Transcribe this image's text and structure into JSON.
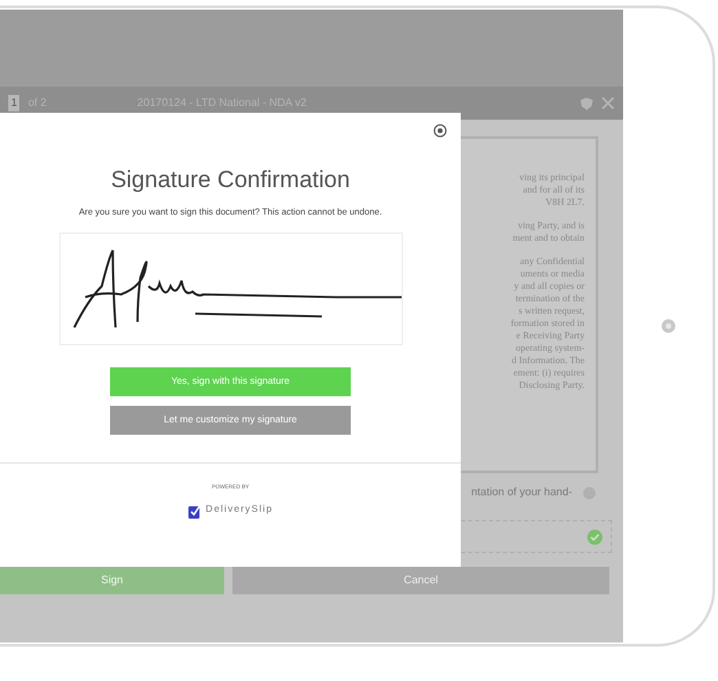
{
  "toolbar": {
    "page": "1",
    "page_count": "of 2",
    "document_title": "20170124 - LTD National - NDA v2"
  },
  "document": {
    "paragraphs": [
      [
        "ving its principal",
        "and for all of its",
        "V8H 2L7."
      ],
      [
        "ving Party, and is",
        "ment and to obtain"
      ],
      [
        "any Confidential",
        "uments or media",
        "y and all copies or",
        "termination of the",
        "s written request,",
        "formation stored in",
        "e Receiving Party",
        "operating system-",
        "d Information. The",
        "ement: (i) requires",
        "Disclosing Party."
      ]
    ]
  },
  "consent_text": "ntation of your hand-",
  "footer_buttons": [
    {
      "label": "Sign",
      "kind": "primary"
    },
    {
      "label": "Cancel",
      "kind": "secondary"
    }
  ],
  "dialog": {
    "title": "Signature Confirmation",
    "message": "Are you sure you want to sign this document? This action cannot be undone.",
    "buttons": [
      {
        "label": "Yes, sign with this signature",
        "kind": "primary"
      },
      {
        "label": "Let me customize my signature",
        "kind": "secondary"
      }
    ],
    "powered_by": "POWERED BY",
    "brand": "DeliverySlip"
  }
}
